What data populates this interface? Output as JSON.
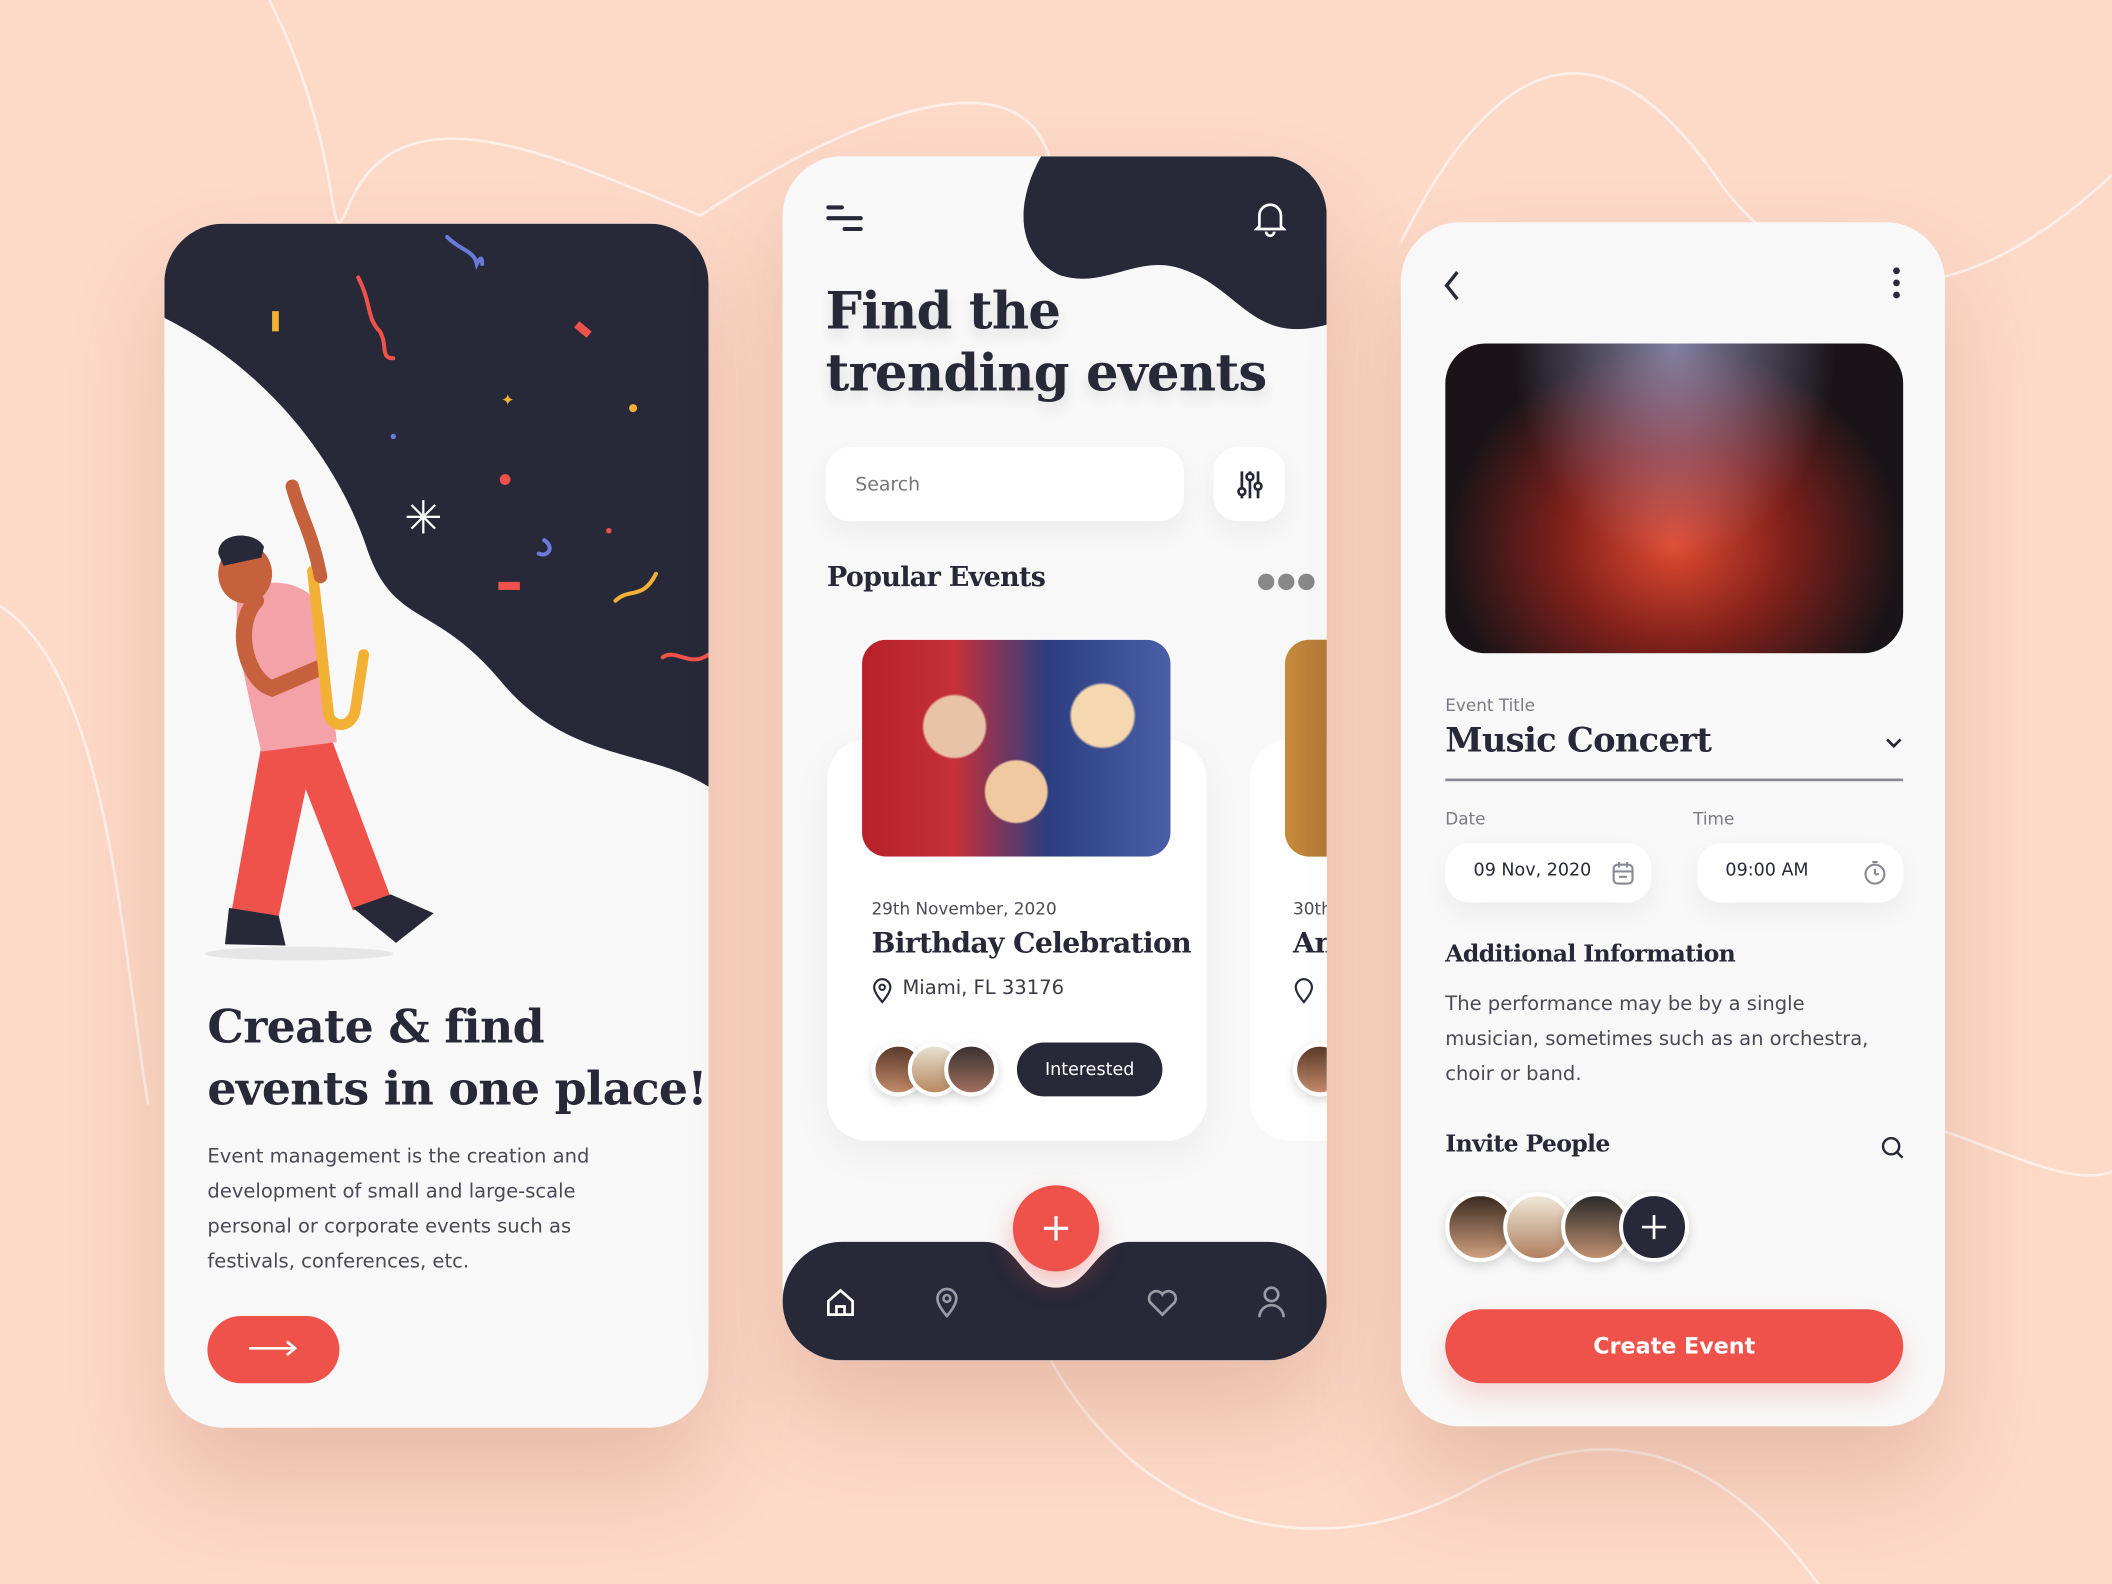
{
  "colors": {
    "background": "#fdd9c8",
    "dark": "#272838",
    "accent": "#ef524a",
    "surface": "#f8f8f8"
  },
  "onboarding": {
    "title_line1": "Create & find",
    "title_line2": "events in one place!",
    "description": "Event management is the creation and development of small and large-scale personal or corporate events such as festivals, conferences, etc.",
    "next_icon": "arrow-right-icon"
  },
  "home": {
    "menu_icon": "menu-icon",
    "notification_icon": "bell-icon",
    "title_line1": "Find the",
    "title_line2": "trending events",
    "search_placeholder": "Search",
    "filter_icon": "sliders-icon",
    "section_title": "Popular Events",
    "more_icon": "more-horizontal-icon",
    "events": [
      {
        "date": "29th November, 2020",
        "title": "Birthday Celebration",
        "location": "Miami, FL 33176",
        "action": "Interested"
      },
      {
        "date": "30th",
        "title": "An",
        "location": ""
      }
    ],
    "nav": [
      "home-icon",
      "location-icon",
      "add-icon",
      "heart-icon",
      "user-icon"
    ]
  },
  "create": {
    "back_icon": "chevron-left-icon",
    "more_icon": "more-vertical-icon",
    "event_title_label": "Event Title",
    "event_title_value": "Music Concert",
    "date_label": "Date",
    "date_value": "09 Nov, 2020",
    "time_label": "Time",
    "time_value": "09:00 AM",
    "info_title": "Additional Information",
    "info_text": "The performance may be by a single musician, sometimes such as an orchestra, choir or band.",
    "invite_title": "Invite People",
    "submit_label": "Create Event"
  }
}
